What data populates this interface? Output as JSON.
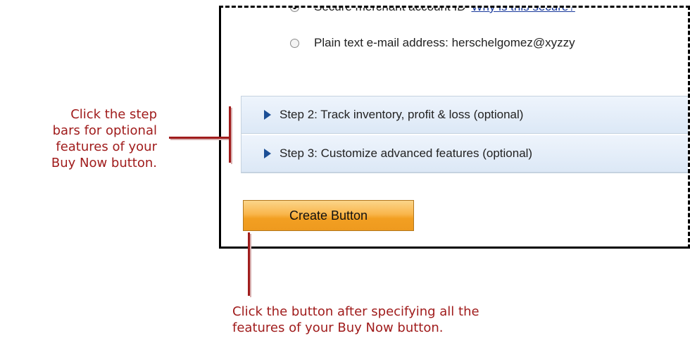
{
  "form": {
    "radio_secure_label": "Secure merchant account ID",
    "radio_secure_link": "Why is this secure?",
    "radio_plain_label": "Plain text e-mail address: herschelgomez@xyzzy"
  },
  "steps": [
    {
      "label": "Step 2: Track inventory, profit & loss (optional)"
    },
    {
      "label": "Step 3: Customize advanced features (optional)"
    }
  ],
  "create_button": {
    "label": "Create Button"
  },
  "annotations": {
    "step_bars": "Click the step\nbars for optional\nfeatures of your\nBuy Now button.",
    "create_button": "Click the button after specifying all the\nfeatures of your Buy Now button."
  },
  "colors": {
    "annotation": "#a01c1c",
    "link": "#1a3a9c",
    "button": "#f9b64c",
    "step_bar": "#dce8f6"
  }
}
